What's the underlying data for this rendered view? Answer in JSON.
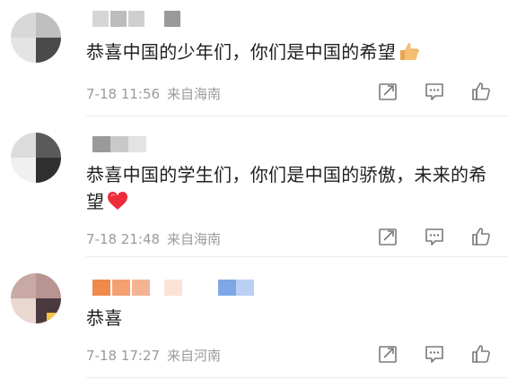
{
  "comments": [
    {
      "text": "恭喜中国的少年们，你们是中国的希望",
      "emoji": "thumbs-up",
      "time": "7-18 11:56",
      "location": "来自海南"
    },
    {
      "text": "恭喜中国的学生们，你们是中国的骄傲，未来的希望",
      "emoji": "red-heart",
      "time": "7-18 21:48",
      "location": "来自海南"
    },
    {
      "text": "恭喜",
      "time": "7-18 17:27",
      "location": "来自河南"
    }
  ],
  "icons": {
    "share": "share-icon",
    "comment": "comment-icon",
    "like": "like-icon"
  },
  "colors": {
    "text": "#1f1f1f",
    "meta": "#9b9b9b",
    "heart": "#ee2b3b",
    "thumb": "#f3b564"
  }
}
